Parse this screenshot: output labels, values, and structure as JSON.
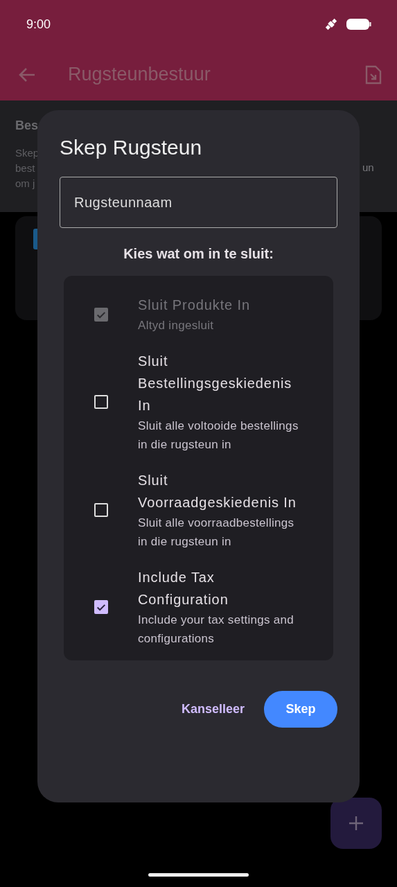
{
  "status_bar": {
    "time": "9:00"
  },
  "app_bar": {
    "title": "Rugsteunbestuur"
  },
  "background": {
    "heading": "Bes",
    "description_lines": [
      "Skep",
      "best",
      "om j"
    ],
    "description_fragment": "un"
  },
  "dialog": {
    "title": "Skep Rugsteun",
    "name_field": {
      "placeholder": "Rugsteunnaam"
    },
    "prompt": "Kies wat om in te sluit:",
    "options": [
      {
        "title": "Sluit Produkte In",
        "subtitle": "Altyd ingesluit",
        "checked": true,
        "disabled": true
      },
      {
        "title": "Sluit Bestellingsgeskiedenis In",
        "subtitle": "Sluit alle voltooide bestellings in die rugsteun in",
        "checked": false,
        "disabled": false
      },
      {
        "title": "Sluit Voorraadgeskiedenis In",
        "subtitle": "Sluit alle voorraadbestellings in die rugsteun in",
        "checked": false,
        "disabled": false
      },
      {
        "title": "Include Tax Configuration",
        "subtitle": "Include your tax settings and configurations",
        "checked": true,
        "disabled": false
      }
    ],
    "buttons": [
      {
        "label": "Kanselleer",
        "kind": "text"
      },
      {
        "label": "Skep",
        "kind": "filled"
      }
    ]
  }
}
